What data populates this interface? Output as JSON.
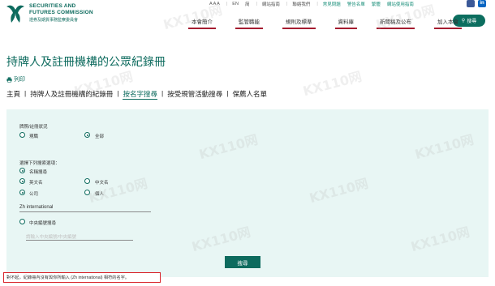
{
  "logo": {
    "line1": "SECURITIES AND",
    "line2": "FUTURES COMMISSION",
    "line3": "證券及期貨事務監察委員會"
  },
  "utility": {
    "font_sizes": "A A A",
    "lang": "EN",
    "simplified": "简",
    "items": [
      "網站指南",
      "聯絡我們",
      "常見問題",
      "警告名單",
      "繁體",
      "網站使用指南"
    ]
  },
  "search_button": "搜尋",
  "main_nav": [
    "本會簡介",
    "監管職能",
    "規則及標準",
    "資料庫",
    "新聞稿及公布",
    "加入本會"
  ],
  "page_title": "持牌人及註冊機構的公眾紀錄冊",
  "print_label": "列印",
  "sub_nav": {
    "items": [
      "主頁",
      "持牌人及註冊機構的紀錄冊",
      "按名字搜尋",
      "按受規管活動搜尋",
      "保薦人名單"
    ],
    "active_index": 2
  },
  "form": {
    "status_label": "牌照/註冊狀況",
    "status_options": [
      "現職",
      "全部"
    ],
    "status_selected": 1,
    "criteria_label": "選擇下列搜索選項：",
    "by_name_label": "名稱搜尋",
    "lang_options": [
      "英文名",
      "中文名"
    ],
    "lang_selected": 0,
    "type_options": [
      "公司",
      "個人"
    ],
    "type_selected": 0,
    "name_value": "Zh international",
    "by_ce_label": "中央編號搜尋",
    "ce_placeholder": "請輸入中央編號/中央編號",
    "submit_label": "搜尋"
  },
  "result_message": "對不起，紀錄冊內沒有與你所輸入 (Zh international) 相符的名字。",
  "watermark": "KX110网"
}
